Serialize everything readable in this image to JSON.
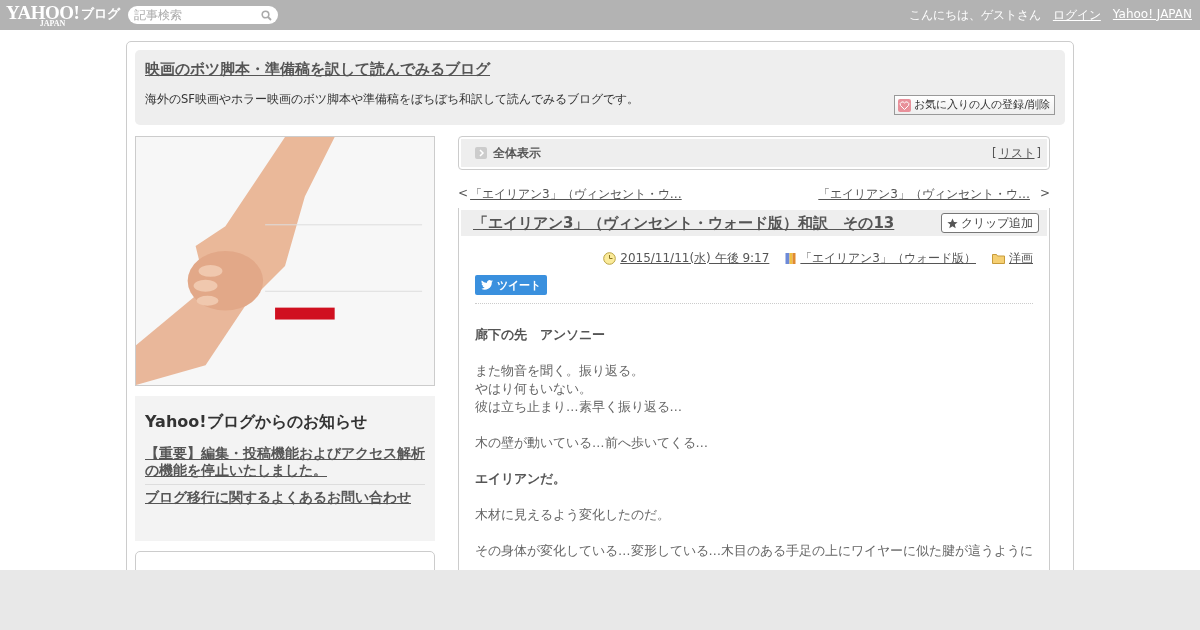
{
  "header": {
    "logo": "YAHOO!",
    "logo_sub": "JAPAN",
    "service": "ブログ",
    "search": {
      "placeholder": "記事検索"
    },
    "greeting": "こんにちは、ゲストさん",
    "links": [
      "ログイン",
      "Yahoo! JAPAN"
    ]
  },
  "blog": {
    "title": "映画のボツ脚本・準備稿を訳して読んでみるブログ",
    "description": "海外のSF映画やホラー映画のボツ脚本や準備稿をぼちぼち和訳して読んでみるブログです。",
    "favorite_button": "お気に入りの人の登録/削除"
  },
  "sidebar": {
    "notice": {
      "title": "Yahoo!ブログからのお知らせ",
      "links": [
        "【重要】編集・投稿機能およびアクセス解析の機能を停止いたしました。",
        "ブログ移行に関するよくあるお問い合わせ"
      ]
    }
  },
  "article_bar": {
    "label": "全体表示",
    "bracket_left": "[",
    "list_link": "リスト",
    "bracket_right": "]"
  },
  "pager": {
    "prev_mark": "<",
    "prev": "「エイリアン3」（ヴィンセント・ウ…",
    "next": "「エイリアン3」（ヴィンセント・ウ…",
    "next_mark": ">"
  },
  "article": {
    "title": "「エイリアン3」（ヴィンセント・ウォード版）和訳　その13",
    "clip_button": "クリップ追加",
    "date": "2015/11/11(水) 午後 9:17",
    "book": "「エイリアン3」（ウォード版）",
    "folder": "洋画",
    "tweet": "ツイート",
    "body": [
      {
        "kind": "bold",
        "lines": [
          "廊下の先　アンソニー"
        ]
      },
      {
        "kind": "plain",
        "lines": [
          "また物音を聞く。振り返る。",
          "やはり何もいない。",
          "彼は立ち止まり…素早く振り返る…"
        ]
      },
      {
        "kind": "plain",
        "lines": [
          "木の壁が動いている…前へ歩いてくる…"
        ]
      },
      {
        "kind": "bold",
        "lines": [
          "エイリアンだ。"
        ]
      },
      {
        "kind": "plain",
        "lines": [
          "木材に見えるよう変化したのだ。"
        ]
      },
      {
        "kind": "plain",
        "lines": [
          "その身体が変化している…変形している…木目のある手足の上にワイヤーに似た腱が這うように"
        ]
      }
    ]
  }
}
